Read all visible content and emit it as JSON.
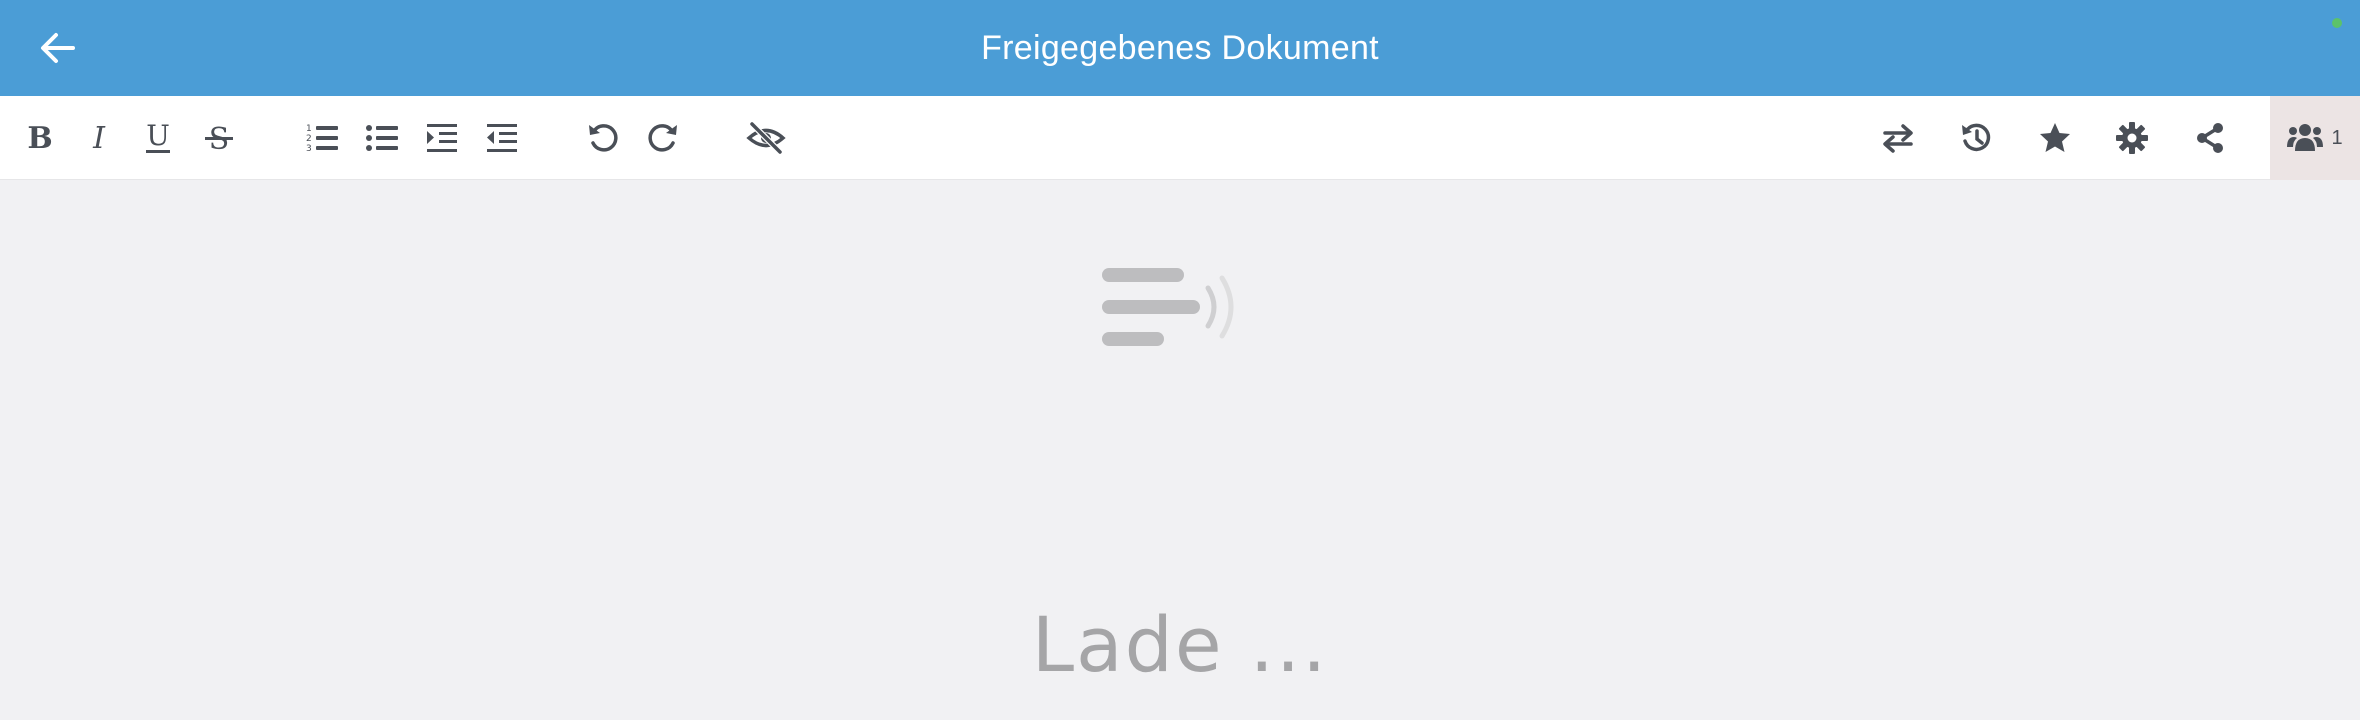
{
  "header": {
    "title": "Freigegebenes Dokument",
    "back_icon": "arrow-left-icon",
    "status_color": "#5cc26a",
    "background": "#4b9dd6"
  },
  "toolbar": {
    "format_buttons": [
      "bold-icon",
      "italic-icon",
      "underline-icon",
      "strikethrough-icon"
    ],
    "list_buttons": [
      "ordered-list-icon",
      "bullet-list-icon",
      "indent-icon",
      "outdent-icon"
    ],
    "history_buttons": [
      "undo-icon",
      "redo-icon"
    ],
    "visibility_button": "eye-slash-icon",
    "right_buttons": [
      "swap-icon",
      "history-icon",
      "star-icon",
      "gear-icon",
      "share-icon"
    ],
    "users": {
      "icon": "users-icon",
      "count": "1"
    }
  },
  "content": {
    "loading_label": "Lade ...",
    "loader_icon": "loading-doc-icon"
  }
}
